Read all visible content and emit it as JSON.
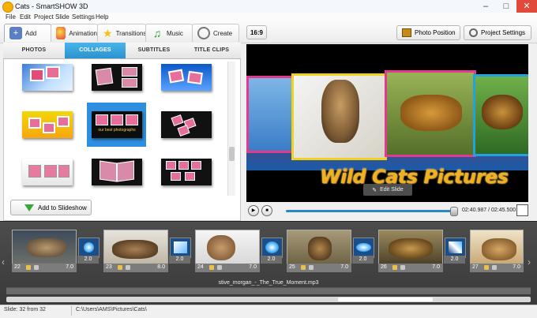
{
  "window": {
    "title": "Cats - SmartSHOW 3D",
    "minimize": "–",
    "maximize": "□",
    "close": "✕"
  },
  "menu": [
    "File",
    "Edit",
    "Project",
    "Slide",
    "Settings",
    "Help"
  ],
  "toolbar": {
    "tabs": [
      {
        "label": "Add",
        "icon": "add-icon"
      },
      {
        "label": "Animation",
        "icon": "palette-icon"
      },
      {
        "label": "Transitions",
        "icon": "star-icon"
      },
      {
        "label": "Music",
        "icon": "music-note-icon"
      },
      {
        "label": "Create",
        "icon": "film-reel-icon"
      }
    ],
    "ratio": "16:9",
    "photo_position": "Photo Position",
    "project_settings": "Project Settings"
  },
  "library": {
    "subtabs": [
      "PHOTOS",
      "COLLAGES",
      "SUBTITLES",
      "TITLE CLIPS"
    ],
    "active_subtab": "COLLAGES",
    "selected_thumb_caption": "our best photographs",
    "add_button": "Add to Slideshow"
  },
  "preview": {
    "title_text": "Wild Cats Pictures",
    "edit_slide": "Edit Slide",
    "time": "02:40.987 / 02:45.500",
    "progress": 0.97
  },
  "timeline": {
    "slides": [
      {
        "number": "22",
        "duration": "7.0"
      },
      {
        "number": "23",
        "duration": "8.0"
      },
      {
        "number": "24",
        "duration": "7.0"
      },
      {
        "number": "25",
        "duration": "7.0"
      },
      {
        "number": "26",
        "duration": "7.0"
      },
      {
        "number": "27",
        "duration": "7.0"
      }
    ],
    "transitions": [
      "2.0",
      "2.0",
      "2.0",
      "2.0",
      "2.0",
      "2.0"
    ],
    "audio_file": "stive_morgan_-_The_True_Moment.mp3"
  },
  "status": {
    "slide_info": "Slide: 32 from 32",
    "path": "C:\\Users\\AMS\\Pictures\\Cats\\"
  },
  "colors": {
    "accent": "#2a92d0",
    "title_orange": "#f2b01e",
    "timeline_bg": "#444444"
  }
}
